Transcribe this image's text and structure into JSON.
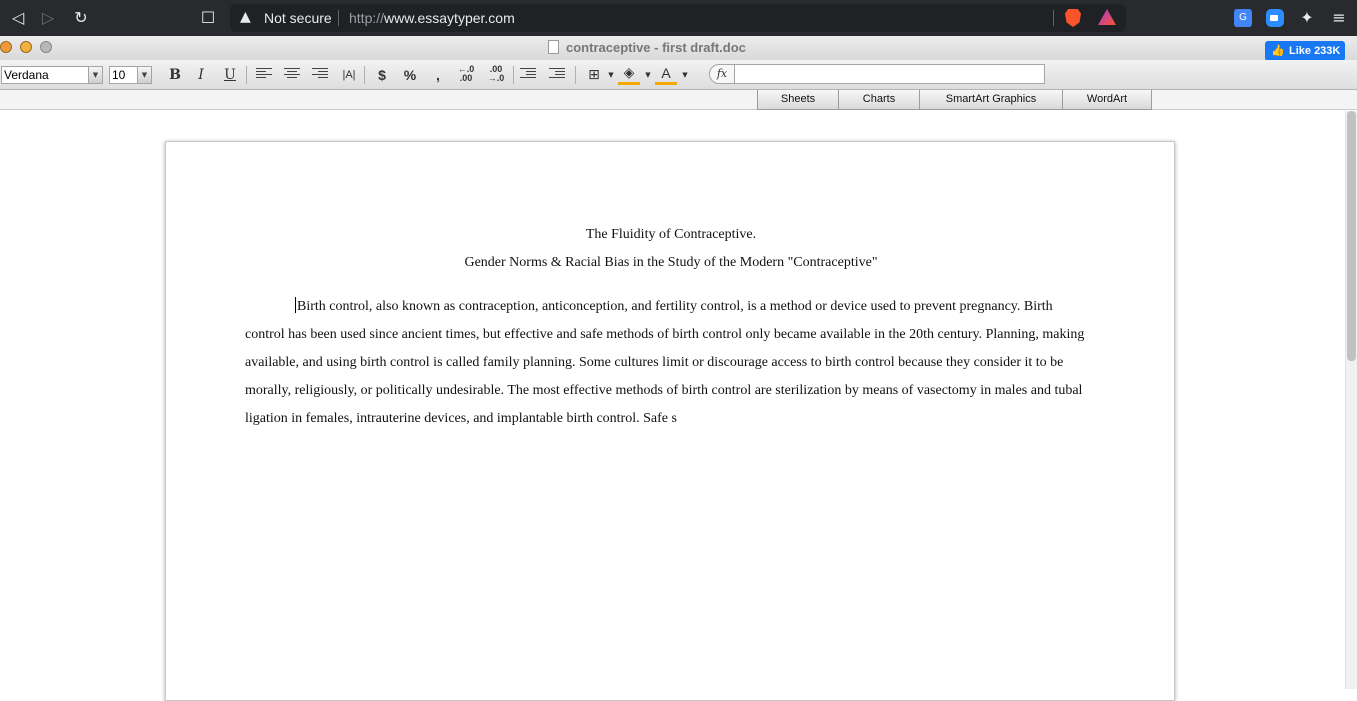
{
  "browser": {
    "security_label": "Not secure",
    "url_prefix": "http://",
    "url_host": "www.essaytyper.com"
  },
  "app": {
    "doc_title": "contraceptive - first draft.doc",
    "like_label": "Like 233K"
  },
  "toolbar": {
    "font_family": "Verdana",
    "font_size": "10",
    "bold": "B",
    "italic": "I",
    "underline": "U",
    "currency": "$",
    "percent": "%",
    "comma": ",",
    "fx": "fx"
  },
  "tabs": [
    "Sheets",
    "Charts",
    "SmartArt Graphics",
    "WordArt"
  ],
  "document": {
    "title": "The Fluidity of Contraceptive.",
    "subtitle": "Gender Norms & Racial Bias in the Study of the Modern \"Contraceptive\"",
    "body": "Birth control, also known as contraception, anticonception, and fertility control, is a method or device used to prevent pregnancy. Birth control has been used since ancient times, but effective and safe methods of birth control only became available in the 20th century. Planning, making available, and using birth control is called family planning. Some cultures limit or discourage access to birth control because they consider it to be morally, religiously, or politically undesirable. The most effective methods of birth control are sterilization by means of vasectomy in males and tubal ligation in females, intrauterine devices, and implantable birth control. Safe s"
  }
}
